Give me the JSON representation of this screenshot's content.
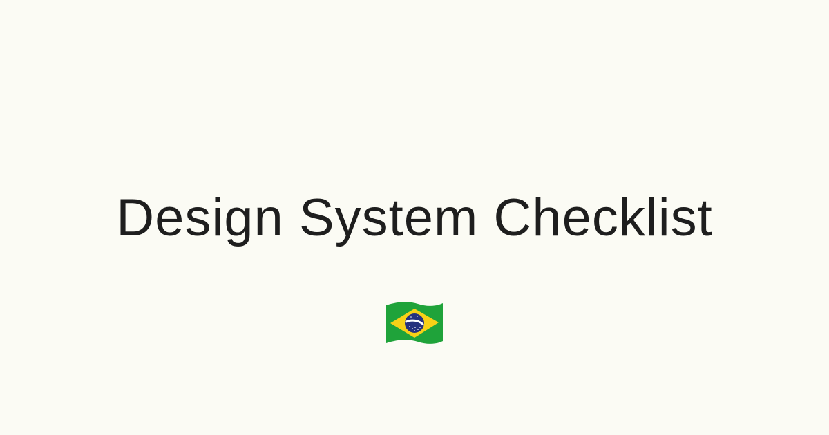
{
  "page": {
    "background_color": "#FBFBF4",
    "title": "Design System Checklist",
    "title_color": "#1E1E1E"
  },
  "flag": {
    "icon": "brazil-flag-icon",
    "colors": {
      "green": "#1FA33A",
      "yellow": "#F7D117",
      "blue": "#25317E",
      "white": "#FFFFFF"
    }
  }
}
